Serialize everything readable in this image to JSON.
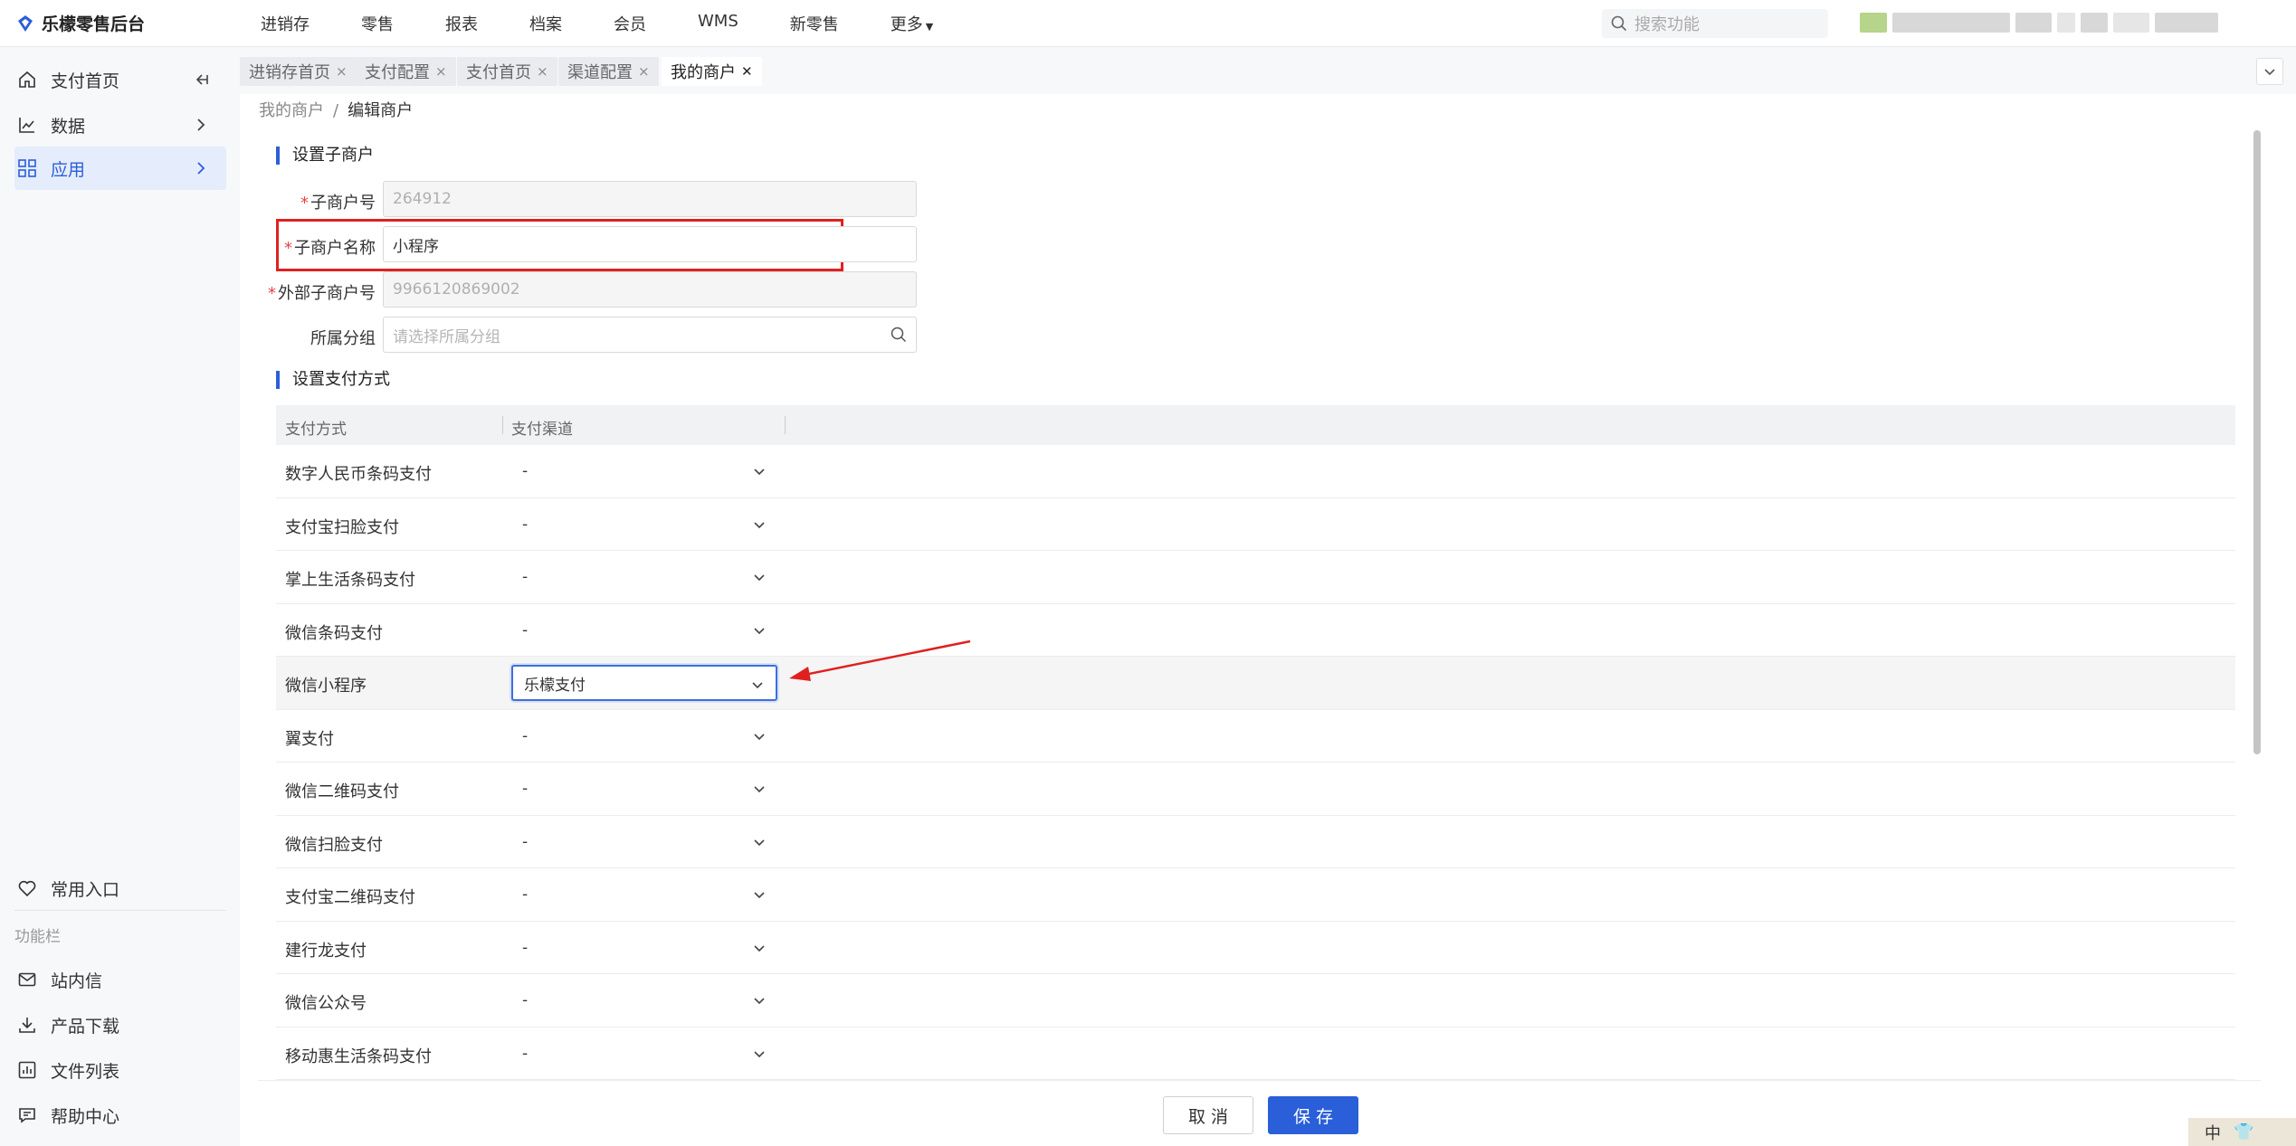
{
  "app": {
    "title": "乐檬零售后台"
  },
  "topnav": [
    "进销存",
    "零售",
    "报表",
    "档案",
    "会员",
    "WMS",
    "新零售",
    "更多"
  ],
  "search": {
    "placeholder": "搜索功能"
  },
  "sidebar": {
    "items": [
      {
        "label": "支付首页",
        "icon": "home-icon"
      },
      {
        "label": "数据",
        "icon": "chart-line-icon"
      },
      {
        "label": "应用",
        "icon": "grid-icon"
      }
    ],
    "bottom": [
      {
        "label": "常用入口",
        "icon": "heart-icon"
      },
      {
        "label": "站内信",
        "icon": "mail-icon"
      },
      {
        "label": "产品下载",
        "icon": "download-icon"
      },
      {
        "label": "文件列表",
        "icon": "bar-chart-icon"
      },
      {
        "label": "帮助中心",
        "icon": "help-chat-icon"
      }
    ],
    "section_label": "功能栏"
  },
  "tabs": [
    {
      "label": "进销存首页",
      "close": "×"
    },
    {
      "label": "支付配置",
      "close": "×"
    },
    {
      "label": "支付首页",
      "close": "×"
    },
    {
      "label": "渠道配置",
      "close": "×"
    },
    {
      "label": "我的商户",
      "close": "✕"
    }
  ],
  "breadcrumb": {
    "parent": "我的商户",
    "separator": "/",
    "current": "编辑商户"
  },
  "sections": {
    "sub_merchant": "设置子商户",
    "payment_methods": "设置支付方式"
  },
  "form": {
    "sub_merchant_no": {
      "label": "子商户号",
      "value": "264912"
    },
    "sub_merchant_name": {
      "label": "子商户名称",
      "value": "小程序"
    },
    "external_no": {
      "label": "外部子商户号",
      "value": "9966120869002"
    },
    "group": {
      "label": "所属分组",
      "placeholder": "请选择所属分组"
    },
    "required_mark": "*"
  },
  "table": {
    "headers": [
      "支付方式",
      "支付渠道"
    ],
    "rows": [
      {
        "method": "数字人民币条码支付",
        "channel": "-"
      },
      {
        "method": "支付宝扫脸支付",
        "channel": "-"
      },
      {
        "method": "掌上生活条码支付",
        "channel": "-"
      },
      {
        "method": "微信条码支付",
        "channel": "-"
      },
      {
        "method": "微信小程序",
        "channel": "乐檬支付"
      },
      {
        "method": "翼支付",
        "channel": "-"
      },
      {
        "method": "微信二维码支付",
        "channel": "-"
      },
      {
        "method": "微信扫脸支付",
        "channel": "-"
      },
      {
        "method": "支付宝二维码支付",
        "channel": "-"
      },
      {
        "method": "建行龙支付",
        "channel": "-"
      },
      {
        "method": "微信公众号",
        "channel": "-"
      },
      {
        "method": "移动惠生活条码支付",
        "channel": "-"
      }
    ]
  },
  "footer": {
    "cancel": "取 消",
    "save": "保 存"
  },
  "ime": {
    "label": "中"
  },
  "colors": {
    "primary": "#2a5fd9",
    "highlight": "#e02020",
    "required": "#e54545"
  }
}
